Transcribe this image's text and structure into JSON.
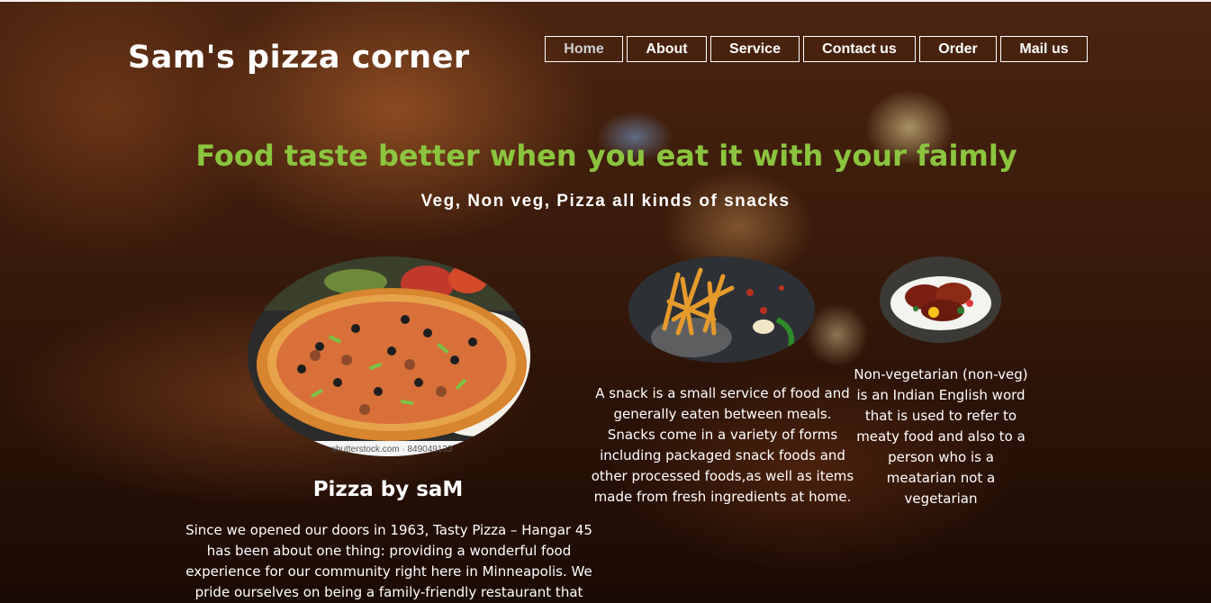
{
  "site": {
    "brand": "Sam's pizza corner"
  },
  "nav": {
    "items": [
      {
        "label": "Home",
        "active": true
      },
      {
        "label": "About"
      },
      {
        "label": "Service"
      },
      {
        "label": "Contact us"
      },
      {
        "label": "Order"
      },
      {
        "label": "Mail us"
      }
    ]
  },
  "hero": {
    "headline": "Food taste better when you eat it with your faimly",
    "subline": "Veg, Non veg, Pizza all kinds of snacks"
  },
  "cards": {
    "pizza": {
      "image_icon": "pizza-image",
      "watermark": "shutterstock.com · 849049133",
      "title": "Pizza by saM",
      "text": "Since we opened our doors in 1963, Tasty Pizza – Hangar 45 has been about one thing: providing a wonderful food experience for our community right here in Minneapolis. We pride ourselves on being a family-friendly restaurant that"
    },
    "snack": {
      "image_icon": "fries-image",
      "text": "A snack is a small service of food and generally eaten between meals. Snacks come in a variety of forms including packaged snack foods and other processed foods,as well as items made from fresh ingredients at home."
    },
    "nonveg": {
      "image_icon": "chicken-image",
      "text": "Non-vegetarian (non-veg) is an Indian English word that is used to refer to meaty food and also to a person who is a meatarian not a vegetarian"
    }
  },
  "colors": {
    "headline": "#8bc53f",
    "text": "#ffffff",
    "nav_border": "#ffffff"
  }
}
